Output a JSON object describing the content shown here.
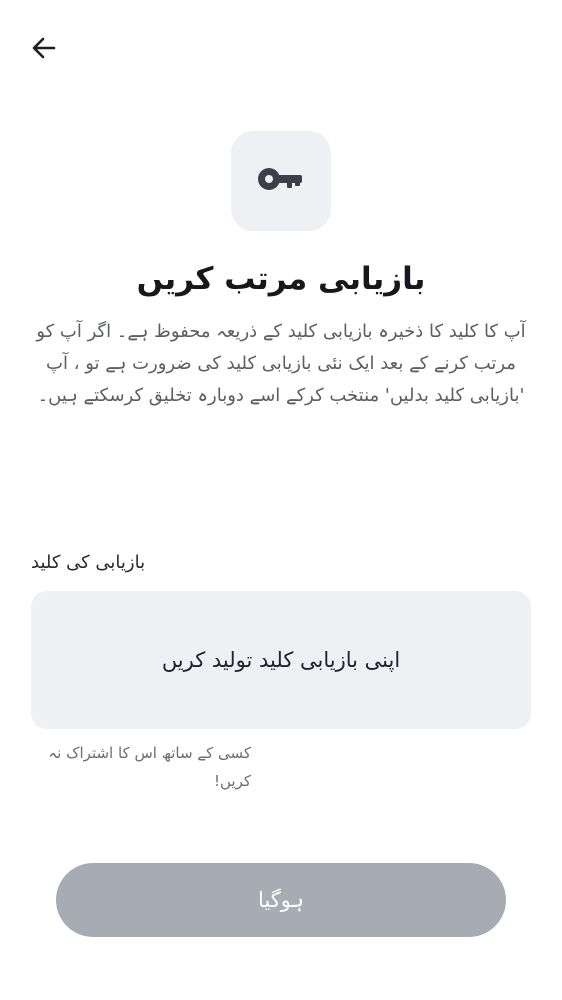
{
  "header": {
    "back_icon": "arrow-left-icon"
  },
  "hero": {
    "icon": "key-icon",
    "title": "بازیابی مرتب کریں",
    "description": "آپ کا کلید کا ذخیرہ بازیابی کلید کے ذریعہ محفوظ ہے۔ اگر آپ کو مرتب کرنے کے بعد ایک نئی بازیابی کلید کی ضرورت ہے تو ، آپ 'بازیابی کلید بدلیں' منتخب کرکے اسے دوبارہ تخلیق کرسکتے ہیں۔"
  },
  "recovery_key": {
    "label": "بازیابی کی کلید",
    "generate_label": "اپنی بازیابی کلید تولید کریں",
    "warning": "کسی کے ساتھ اس کا اشتراک نہ کریں!"
  },
  "footer": {
    "done_label": "ہوگیا"
  },
  "colors": {
    "tile_background": "#eff0f4",
    "button_disabled": "#a6abb4",
    "icon": "#3d3f47"
  }
}
